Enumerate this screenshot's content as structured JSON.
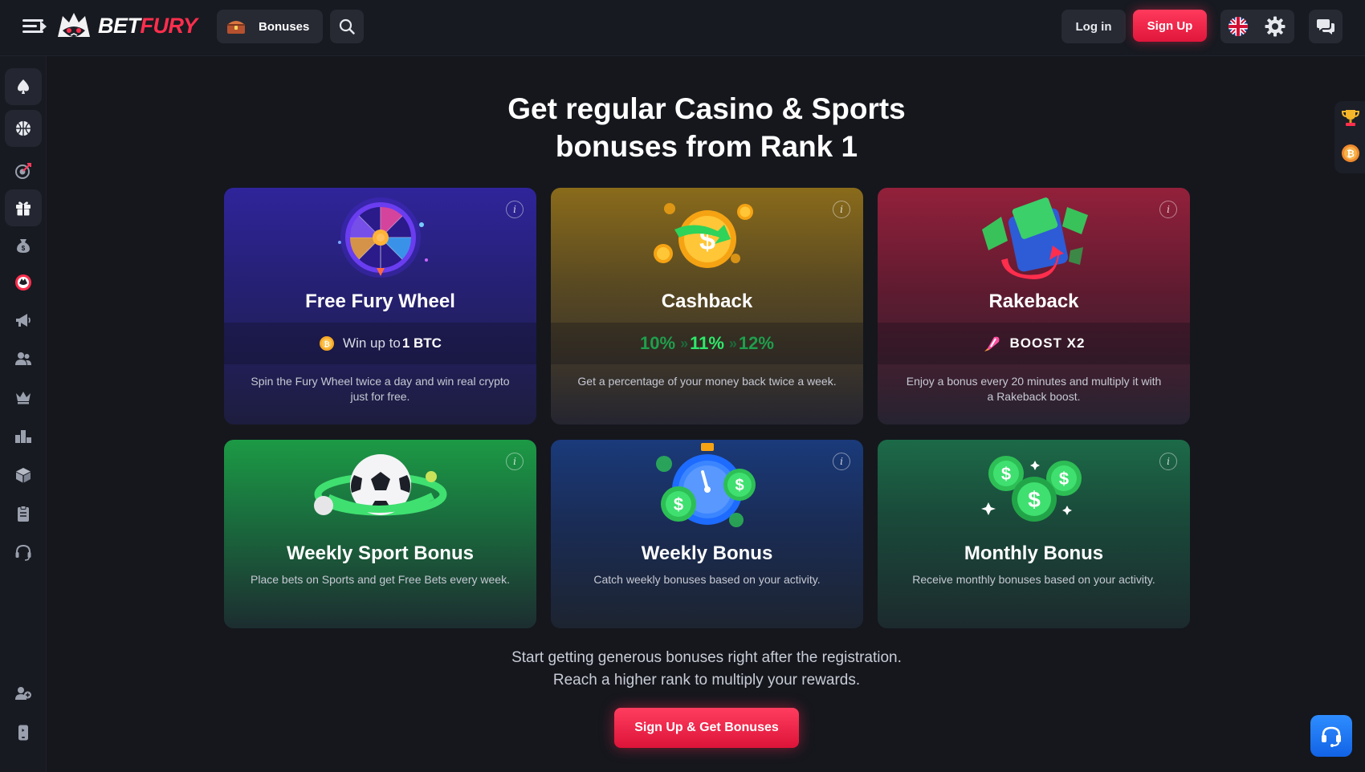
{
  "header": {
    "logo": {
      "bet": "BET",
      "fury": "FURY"
    },
    "bonuses_label": "Bonuses",
    "login_label": "Log in",
    "signup_label": "Sign Up",
    "icons": [
      "menu-icon",
      "chest-icon",
      "search-icon",
      "uk-flag-icon",
      "gear-icon",
      "chat-icon"
    ]
  },
  "sidebar": {
    "items": [
      {
        "name": "casino",
        "icon": "spade-icon"
      },
      {
        "name": "sports",
        "icon": "basketball-icon"
      },
      {
        "name": "target",
        "icon": "target-icon"
      },
      {
        "name": "bonuses",
        "icon": "gift-icon"
      },
      {
        "name": "money-bag",
        "icon": "money-bag-icon"
      },
      {
        "name": "fury-coin",
        "icon": "fury-coin-icon"
      },
      {
        "name": "promotions",
        "icon": "megaphone-icon"
      },
      {
        "name": "affiliate",
        "icon": "users-icon"
      },
      {
        "name": "vip",
        "icon": "crown-icon"
      },
      {
        "name": "leaderboard",
        "icon": "podium-icon"
      },
      {
        "name": "staking",
        "icon": "cube-icon"
      },
      {
        "name": "tasks",
        "icon": "clipboard-icon"
      },
      {
        "name": "support",
        "icon": "headset-icon"
      },
      {
        "name": "refer",
        "icon": "user-add-icon"
      },
      {
        "name": "app",
        "icon": "mobile-icon"
      }
    ]
  },
  "main": {
    "headline_line1": "Get regular Casino & Sports",
    "headline_line2": "bonuses from Rank 1",
    "cards": {
      "wheel": {
        "title": "Free Fury Wheel",
        "highlight_prefix": "Win up to ",
        "highlight_value": "1 BTC",
        "desc": "Spin the Fury Wheel twice a day and win real crypto just for free."
      },
      "cashback": {
        "title": "Cashback",
        "p1": "10%",
        "p2": "11%",
        "p3": "12%",
        "arrow": "»",
        "desc": "Get a percentage of your money back twice a week."
      },
      "rakeback": {
        "title": "Rakeback",
        "highlight": "BOOST X2",
        "desc": "Enjoy a bonus every 20 minutes and multiply it with a Rakeback boost."
      },
      "sport": {
        "title": "Weekly Sport Bonus",
        "desc": "Place bets on Sports and get Free Bets every week."
      },
      "weekly": {
        "title": "Weekly Bonus",
        "desc": "Catch weekly bonuses based on your activity."
      },
      "monthly": {
        "title": "Monthly Bonus",
        "desc": "Receive monthly bonuses based on your activity."
      }
    },
    "info_glyph": "i",
    "bottom_line1": "Start getting generous bonuses right after the registration.",
    "bottom_line2": "Reach a higher rank to multiply your rewards.",
    "cta_label": "Sign Up & Get Bonuses"
  },
  "colors": {
    "accent_red": "#ff2e4d",
    "bg": "#15171d",
    "green_percent": "#2ee86b",
    "support_blue": "#1e7bff"
  }
}
